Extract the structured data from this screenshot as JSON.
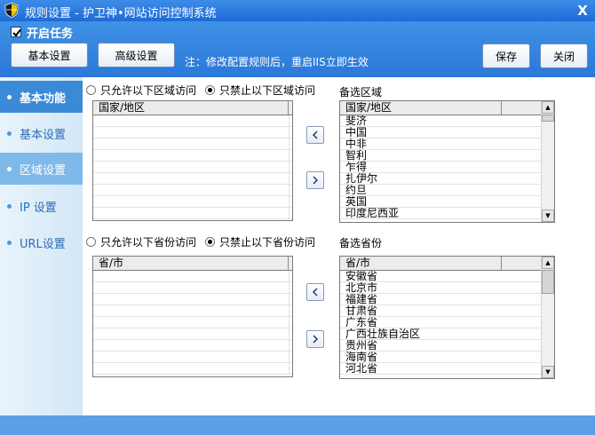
{
  "window": {
    "title": "规则设置 - 护卫神•网站访问控制系统",
    "close_label": "X"
  },
  "toolbar": {
    "enable_task_label": "开启任务",
    "enable_task_checked": true,
    "basic_settings_label": "基本设置",
    "advanced_settings_label": "高级设置",
    "note": "注：修改配置规则后，重启IIS立即生效",
    "save_label": "保存",
    "close_label": "关闭"
  },
  "sidebar": {
    "items": [
      {
        "label": "基本功能",
        "state": "active"
      },
      {
        "label": "基本设置",
        "state": "normal"
      },
      {
        "label": "区域设置",
        "state": "selected"
      },
      {
        "label": "IP 设置",
        "state": "normal"
      },
      {
        "label": "URL设置",
        "state": "normal"
      }
    ]
  },
  "region": {
    "allow_label": "只允许以下区域访问",
    "deny_label": "只禁止以下区域访问",
    "selected_option": "deny",
    "list_header": "国家/地区",
    "candidate_title": "备选区域",
    "candidate_header": "国家/地区",
    "candidates": [
      "斐济",
      "中国",
      "中非",
      "智利",
      "乍得",
      "扎伊尔",
      "约旦",
      "英国",
      "印度尼西亚"
    ]
  },
  "province": {
    "allow_label": "只允许以下省份访问",
    "deny_label": "只禁止以下省份访问",
    "selected_option": "deny",
    "list_header": "省/市",
    "candidate_title": "备选省份",
    "candidate_header": "省/市",
    "candidates": [
      "安徽省",
      "北京市",
      "福建省",
      "甘肃省",
      "广东省",
      "广西壮族自治区",
      "贵州省",
      "海南省",
      "河北省"
    ]
  },
  "icons": {
    "app": "shield-icon",
    "move_left": "chevron-left-icon",
    "move_right": "chevron-right-icon"
  },
  "colors": {
    "title_bar": "#1f6ad6",
    "toolbar": "#3f92e6",
    "sidebar_active": "#3a8ad8",
    "sidebar_selected": "#7fb9ea",
    "sidebar_text": "#2a6db8"
  }
}
